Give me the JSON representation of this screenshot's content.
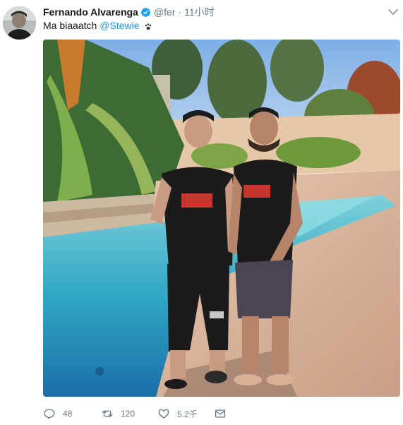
{
  "tweet": {
    "author_name": "Fernando Alvarenga",
    "handle": "@fer",
    "separator": "·",
    "time": "11小时",
    "text": "Ma biaaatch",
    "mention": "@Stewie",
    "emoji": "paw-prints-emoji",
    "verified_icon": "verified-badge-icon",
    "more_icon": "chevron-down-icon"
  },
  "actions": {
    "reply_count": "48",
    "retweet_count": "120",
    "like_count": "5.2千",
    "reply_icon": "reply-icon",
    "retweet_icon": "retweet-icon",
    "like_icon": "heart-icon",
    "dm_icon": "mail-icon"
  },
  "colors": {
    "link": "#1b95e0",
    "verified": "#1da1f2",
    "muted": "#657786",
    "text": "#14171a"
  }
}
